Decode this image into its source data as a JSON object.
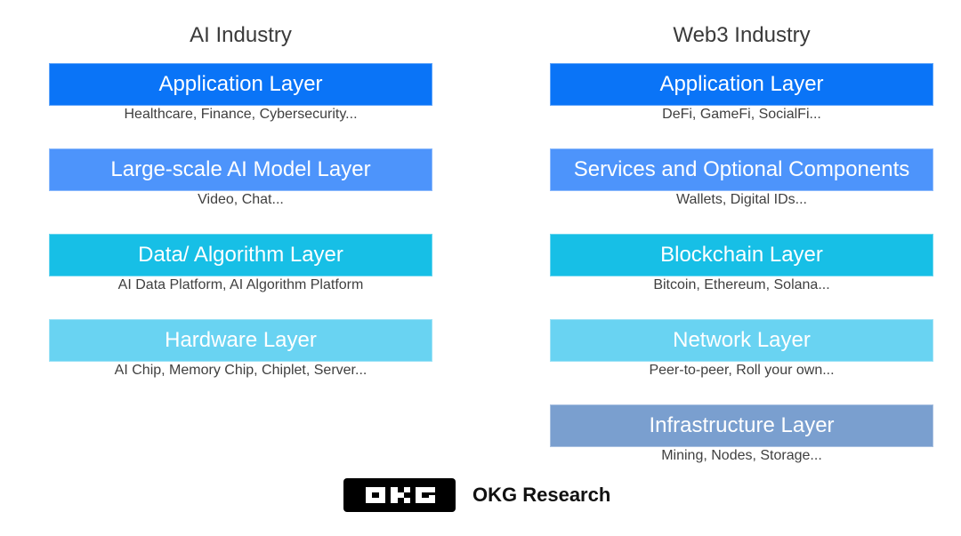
{
  "columns": [
    {
      "title": "AI Industry",
      "layers": [
        {
          "label": "Application Layer",
          "description": "Healthcare, Finance, Cybersecurity...",
          "color": "#0a74f7"
        },
        {
          "label": "Large-scale AI Model Layer",
          "description": "Video, Chat...",
          "color": "#4d94fb"
        },
        {
          "label": "Data/ Algorithm Layer",
          "description": "AI Data Platform, AI Algorithm Platform",
          "color": "#17bfe6"
        },
        {
          "label": "Hardware Layer",
          "description": "AI Chip, Memory Chip, Chiplet, Server...",
          "color": "#69d3f2"
        }
      ]
    },
    {
      "title": "Web3 Industry",
      "layers": [
        {
          "label": "Application Layer",
          "description": "DeFi, GameFi, SocialFi...",
          "color": "#0a74f7"
        },
        {
          "label": "Services and Optional Components",
          "description": "Wallets, Digital IDs...",
          "color": "#4d94fb"
        },
        {
          "label": "Blockchain Layer",
          "description": "Bitcoin, Ethereum, Solana...",
          "color": "#17bfe6"
        },
        {
          "label": "Network Layer",
          "description": "Peer-to-peer,  Roll your own...",
          "color": "#69d3f2"
        },
        {
          "label": "Infrastructure Layer",
          "description": "Mining, Nodes, Storage...",
          "color": "#7a9fcf"
        }
      ]
    }
  ],
  "footer": {
    "logo_icon": "okg-logo-icon",
    "brand": "OKG Research"
  }
}
